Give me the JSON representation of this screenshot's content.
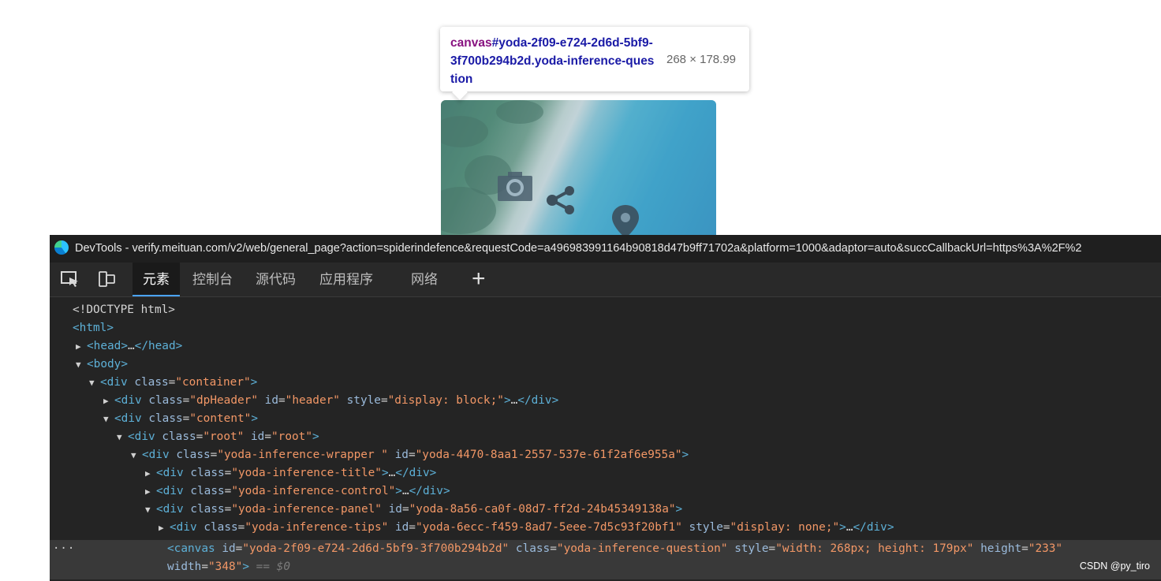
{
  "tooltip": {
    "tag": "canvas",
    "selector": "#yoda-2f09-e724-2d6d-5bf9-3f700b294b2d.yoda-inference-question",
    "dimensions": "268 × 178.99"
  },
  "preview": {
    "icons": [
      "camera-icon",
      "share-icon",
      "location-pin-icon"
    ]
  },
  "devtools": {
    "title": "DevTools - verify.meituan.com/v2/web/general_page?action=spiderindefence&requestCode=a496983991164b90818d47b9ff71702a&platform=1000&adaptor=auto&succCallbackUrl=https%3A%2F%2",
    "tabs": [
      {
        "label": "元素",
        "active": true
      },
      {
        "label": "控制台",
        "active": false
      },
      {
        "label": "源代码",
        "active": false
      },
      {
        "label": "应用程序",
        "active": false
      },
      {
        "label": "网络",
        "active": false
      }
    ],
    "add_tab_label": "+",
    "doctype": "<!DOCTYPE html>",
    "html_open": "<html>",
    "head": {
      "open": "<head>",
      "ellipsis": "…",
      "close": "</head>"
    },
    "body_open": "<body>",
    "nodes": {
      "container": {
        "tag": "div",
        "attr": "class",
        "val": "\"container\""
      },
      "header": {
        "tag": "div",
        "a1": "class",
        "v1": "\"dpHeader\"",
        "a2": "id",
        "v2": "\"header\"",
        "a3": "style",
        "v3": "\"display: block;\"",
        "ellipsis": "…",
        "close": "</div>"
      },
      "content": {
        "tag": "div",
        "attr": "class",
        "val": "\"content\""
      },
      "root": {
        "tag": "div",
        "a1": "class",
        "v1": "\"root\"",
        "a2": "id",
        "v2": "\"root\""
      },
      "wrapper": {
        "tag": "div",
        "a1": "class",
        "v1": "\"yoda-inference-wrapper \"",
        "a2": "id",
        "v2": "\"yoda-4470-8aa1-2557-537e-61f2af6e955a\""
      },
      "title": {
        "tag": "div",
        "attr": "class",
        "val": "\"yoda-inference-title\"",
        "ellipsis": "…",
        "close": "</div>"
      },
      "control": {
        "tag": "div",
        "attr": "class",
        "val": "\"yoda-inference-control\"",
        "ellipsis": "…",
        "close": "</div>"
      },
      "panel": {
        "tag": "div",
        "a1": "class",
        "v1": "\"yoda-inference-panel\"",
        "a2": "id",
        "v2": "\"yoda-8a56-ca0f-08d7-ff2d-24b45349138a\""
      },
      "tips": {
        "tag": "div",
        "a1": "class",
        "v1": "\"yoda-inference-tips\"",
        "a2": "id",
        "v2": "\"yoda-6ecc-f459-8ad7-5eee-7d5c93f20bf1\"",
        "a3": "style",
        "v3": "\"display: none;\"",
        "ellipsis": "…",
        "close": "</div>"
      },
      "canvas": {
        "tag": "canvas",
        "a1": "id",
        "v1": "\"yoda-2f09-e724-2d6d-5bf9-3f700b294b2d\"",
        "a2": "class",
        "v2": "\"yoda-inference-question\"",
        "a3": "style",
        "v3": "\"width: 268px; height: 179px\"",
        "a4": "height",
        "v4": "\"233\"",
        "a5": "width",
        "v5": "\"348\"",
        "eq": "== $0"
      }
    },
    "gutter_dots": "···",
    "watermark": "CSDN @py_tiro"
  }
}
